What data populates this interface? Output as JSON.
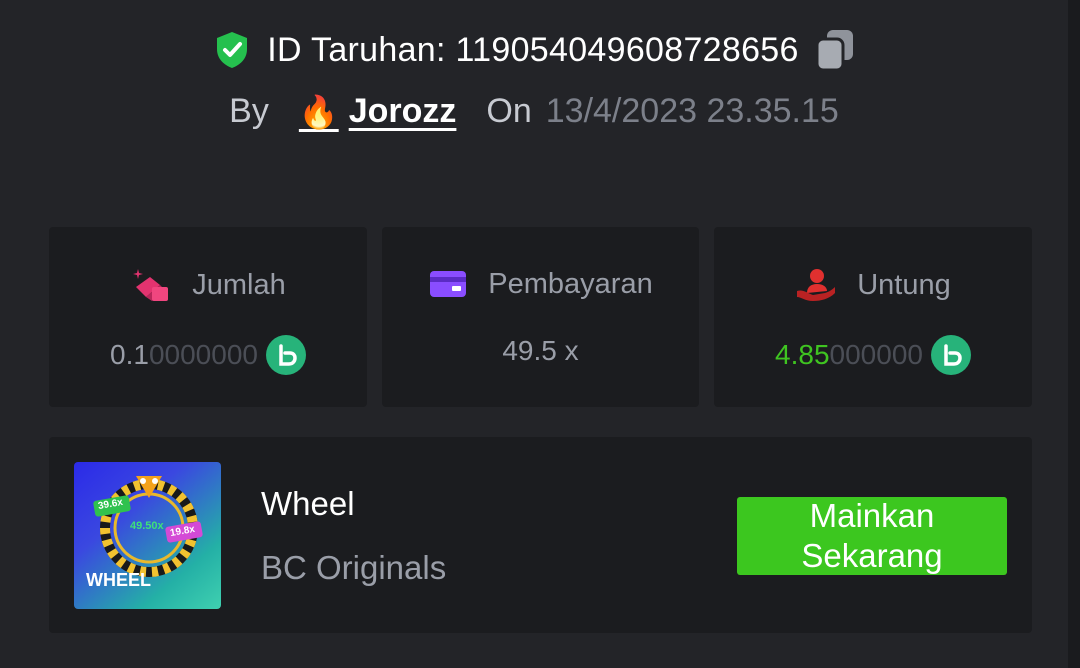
{
  "header": {
    "bet_id": "ID Taruhan: 119054049608728656",
    "by_label": "By",
    "username": "Jorozz",
    "on_label": "On",
    "date": "13/4/2023 23.35.15"
  },
  "stats": [
    {
      "label": "Jumlah",
      "value_main": "0.1",
      "value_dim": "0000000",
      "icon": "bet-amount-icon"
    },
    {
      "label": "Pembayaran",
      "value": "49.5 x",
      "icon": "payout-card-icon"
    },
    {
      "label": "Untung",
      "value_main": "4.85",
      "value_dim": "000000",
      "icon": "profit-hand-icon"
    }
  ],
  "game": {
    "name": "Wheel",
    "provider": "BC Originals",
    "thumb_title": "WHEEL",
    "thumb_multipliers": [
      "39.6x",
      "49.50x",
      "19.8x"
    ],
    "play_label": "Mainkan Sekarang"
  },
  "colors": {
    "background": "#232428",
    "card": "#1b1c1f",
    "accent_green": "#3cc71f",
    "profit_green": "#3fc421",
    "coin": "#27b37a",
    "payout_purple": "#8a4dff",
    "amount_pink": "#e2336f",
    "profit_red": "#e0302f"
  }
}
